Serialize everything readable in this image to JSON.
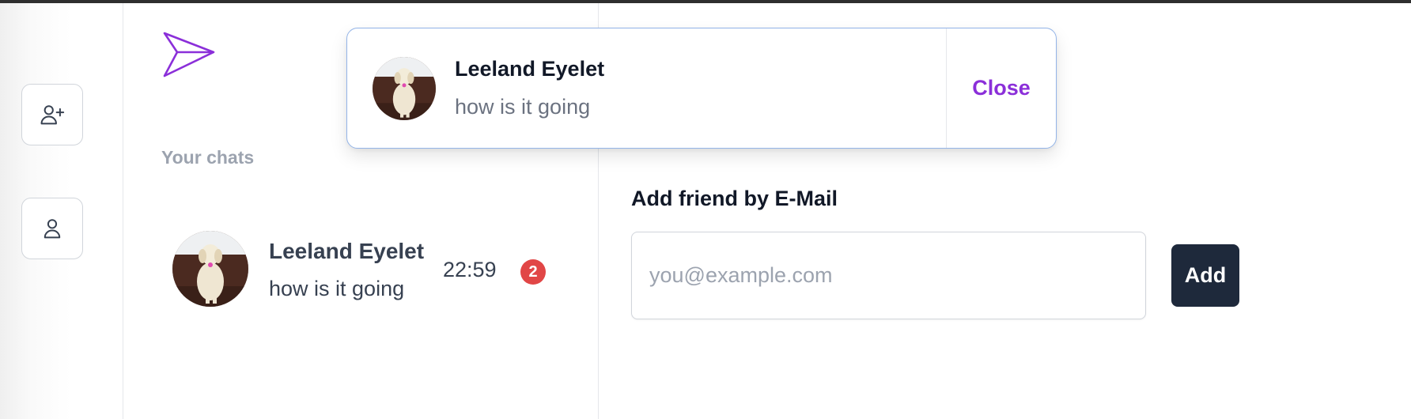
{
  "sidebar": {
    "actions": [
      {
        "icon": "user-plus-icon"
      },
      {
        "icon": "user-icon"
      }
    ],
    "logo_icon": "paper-plane-icon",
    "section_title": "Your chats",
    "chats": [
      {
        "name": "Leeland Eyelet",
        "last_message": "how is it going",
        "time": "22:59",
        "unread": "2"
      }
    ]
  },
  "main": {
    "add_friend_title": "Add friend by E-Mail",
    "email_placeholder": "you@example.com",
    "email_value": "",
    "add_button_label": "Add"
  },
  "toast": {
    "sender_name": "Leeland Eyelet",
    "message": "how is it going",
    "close_label": "Close"
  },
  "colors": {
    "accent": "#8b2fd9",
    "button_dark": "#1e293b",
    "badge_red": "#dc2626",
    "toast_border": "#93b4e8"
  }
}
